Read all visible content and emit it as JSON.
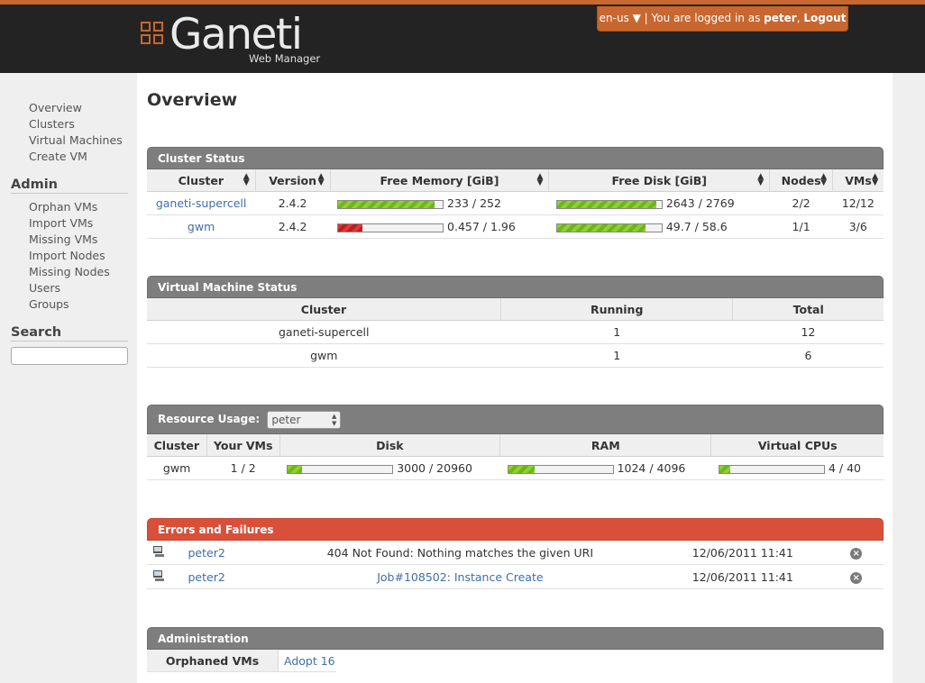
{
  "header": {
    "logo_text": "Ganeti",
    "logo_sub": "Web Manager",
    "lang": "en-us ▼",
    "logged_in_prefix": "| You are logged in as",
    "user": "peter",
    "logout": "Logout"
  },
  "sidebar": {
    "nav": [
      "Overview",
      "Clusters",
      "Virtual Machines",
      "Create VM"
    ],
    "admin_title": "Admin",
    "admin_items": [
      "Orphan VMs",
      "Import VMs",
      "Missing VMs",
      "Import Nodes",
      "Missing Nodes",
      "Users",
      "Groups"
    ],
    "search_title": "Search",
    "search_value": ""
  },
  "page_title": "Overview",
  "cluster_status": {
    "title": "Cluster Status",
    "columns": [
      "Cluster",
      "Version",
      "Free Memory [GiB]",
      "Free Disk [GiB]",
      "Nodes",
      "VMs"
    ],
    "rows": [
      {
        "cluster": "ganeti-supercell",
        "version": "2.4.2",
        "memory": "233 / 252",
        "memory_fraction": 0.92,
        "memory_color": "green",
        "disk": "2643 / 2769",
        "disk_fraction": 0.95,
        "disk_color": "green",
        "nodes": "2/2",
        "vms": "12/12"
      },
      {
        "cluster": "gwm",
        "version": "2.4.2",
        "memory": "0.457 / 1.96",
        "memory_fraction": 0.23,
        "memory_color": "red",
        "disk": "49.7 / 58.6",
        "disk_fraction": 0.85,
        "disk_color": "green",
        "nodes": "1/1",
        "vms": "3/6"
      }
    ]
  },
  "vm_status": {
    "title": "Virtual Machine Status",
    "columns": [
      "Cluster",
      "Running",
      "Total"
    ],
    "rows": [
      {
        "cluster": "ganeti-supercell",
        "running": "1",
        "total": "12"
      },
      {
        "cluster": "gwm",
        "running": "1",
        "total": "6"
      }
    ]
  },
  "resource_usage": {
    "title": "Resource Usage:",
    "selected_user": "peter",
    "columns": [
      "Cluster",
      "Your VMs",
      "Disk",
      "RAM",
      "Virtual CPUs"
    ],
    "rows": [
      {
        "cluster": "gwm",
        "vms": "1 / 2",
        "disk": "3000 / 20960",
        "disk_fraction": 0.14,
        "ram": "1024 / 4096",
        "ram_fraction": 0.25,
        "cpus": "4 / 40",
        "cpus_fraction": 0.1
      }
    ]
  },
  "errors": {
    "title": "Errors and Failures",
    "rows": [
      {
        "object": "peter2",
        "message": "404 Not Found: Nothing matches the given URI",
        "message_is_link": false,
        "time": "12/06/2011 11:41"
      },
      {
        "object": "peter2",
        "message": "Job#108502: Instance Create",
        "message_is_link": true,
        "time": "12/06/2011 11:41"
      }
    ]
  },
  "administration": {
    "title": "Administration",
    "rows": [
      {
        "label": "Orphaned VMs",
        "value": "Adopt 16"
      }
    ]
  },
  "colors": {
    "brand_orange": "#c8672f",
    "header_bg": "#232323",
    "panel_head": "#7e7e7e",
    "error_head": "#d9503a",
    "link": "#3f6ea8"
  }
}
